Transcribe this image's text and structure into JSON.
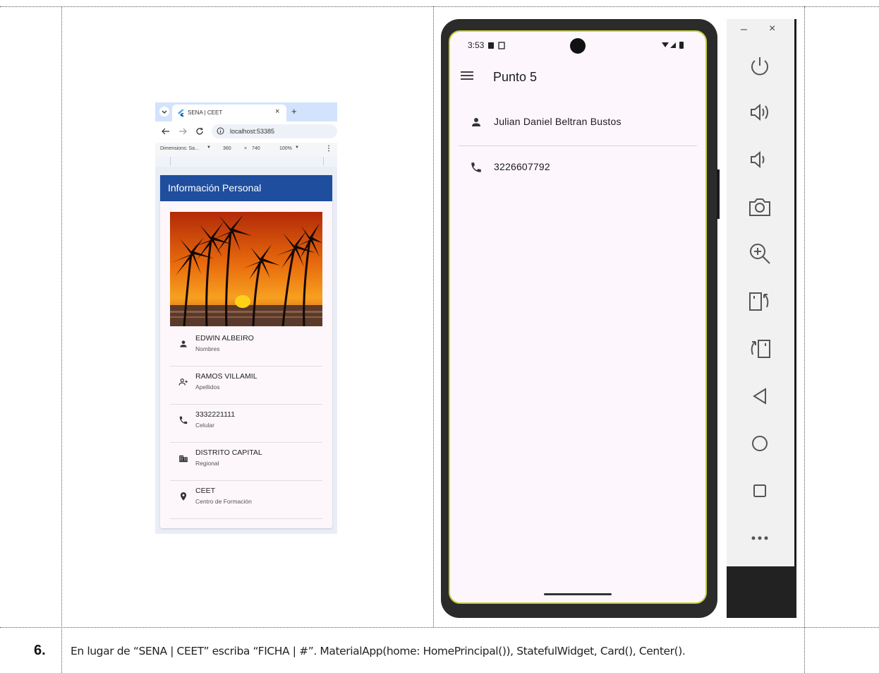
{
  "browser": {
    "tab_title": "SENA | CEET",
    "tab_close": "×",
    "new_tab": "+",
    "url": "localhost:53385",
    "devtools": {
      "dimensions_label": "Dimensions: Sa...",
      "width": "360",
      "times": "×",
      "height": "740",
      "zoom": "100%"
    }
  },
  "web_app": {
    "appbar_title": "Información Personal",
    "items": [
      {
        "title": "EDWIN ALBEIRO",
        "subtitle": "Nombres",
        "icon": "person-icon"
      },
      {
        "title": "RAMOS VILLAMIL",
        "subtitle": "Apellidos",
        "icon": "person-add-icon"
      },
      {
        "title": "3332221111",
        "subtitle": "Celular",
        "icon": "phone-icon"
      },
      {
        "title": "DISTRITO CAPITAL",
        "subtitle": "Regional",
        "icon": "business-icon"
      },
      {
        "title": "CEET",
        "subtitle": "Centro de Formación",
        "icon": "location-pin-icon"
      }
    ]
  },
  "phone": {
    "time": "3:53",
    "app_title": "Punto 5",
    "tiles": [
      {
        "text": "Julian Daniel Beltran Bustos",
        "icon": "person-icon"
      },
      {
        "text": "3226607792",
        "icon": "phone-icon"
      }
    ]
  },
  "emulator": {
    "minimize": "–",
    "close": "×",
    "buttons": [
      "power-icon",
      "volume-up-icon",
      "volume-down-icon",
      "camera-icon",
      "zoom-in-icon",
      "rotate-left-icon",
      "rotate-right-icon",
      "back-icon",
      "home-icon",
      "overview-icon",
      "more-icon"
    ]
  },
  "document": {
    "row_number": "6.",
    "instruction": "En lugar de “SENA | CEET” escriba “FICHA | #”. MaterialApp(home: HomePrincipal()), StatefulWidget, Card(), Center()."
  },
  "colors": {
    "appbar_blue": "#1f4e9e",
    "screen_border": "#c6d23a",
    "screen_bg": "#fdf7fd"
  }
}
